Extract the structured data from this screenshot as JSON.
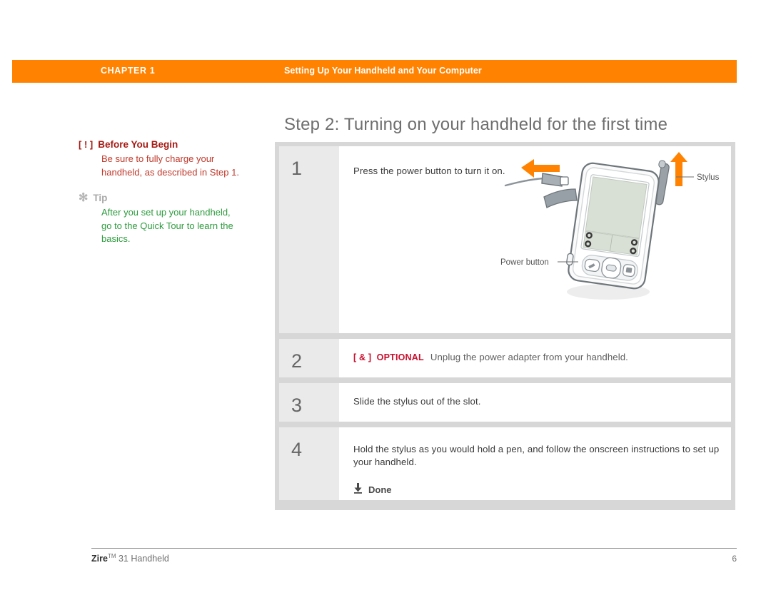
{
  "header": {
    "chapter_label": "CHAPTER 1",
    "section_title": "Setting Up Your Handheld and Your Computer",
    "bar_color": "#FF8200"
  },
  "sidebar": {
    "notes": [
      {
        "icon": "warning-bracket-icon",
        "icon_glyph": "[ ! ]",
        "title": "Before You Begin",
        "body": "Be sure to fully charge your handheld, as described in Step 1.",
        "color": "#A51A14"
      },
      {
        "icon": "asterisk-icon",
        "icon_glyph": "✻",
        "title": "Tip",
        "body": "After you set up your handheld, go to the Quick Tour to learn the basics.",
        "color": "#2E9B3E"
      }
    ]
  },
  "main": {
    "heading": "Step 2: Turning on your handheld for the first time",
    "steps": [
      {
        "number": "1",
        "text": "Press the power button to turn it on.",
        "optional_tag": "",
        "done_label": ""
      },
      {
        "number": "2",
        "text": "Unplug the power adapter from your handheld.",
        "optional_tag": "[ & ]  OPTIONAL",
        "done_label": ""
      },
      {
        "number": "3",
        "text": "Slide the stylus out of the slot.",
        "optional_tag": "",
        "done_label": ""
      },
      {
        "number": "4",
        "text": "Hold the stylus as you would hold a pen, and follow the onscreen instructions to set up your handheld.",
        "optional_tag": "",
        "done_label": "Done"
      }
    ],
    "illustration": {
      "name": "handheld-device-illustration",
      "callout_stylus": "Stylus",
      "callout_power_button": "Power button",
      "arrow_color": "#FF8200"
    }
  },
  "footer": {
    "brand": "Zire",
    "trademark": "TM",
    "product": " 31 Handheld",
    "page_number": "6"
  }
}
